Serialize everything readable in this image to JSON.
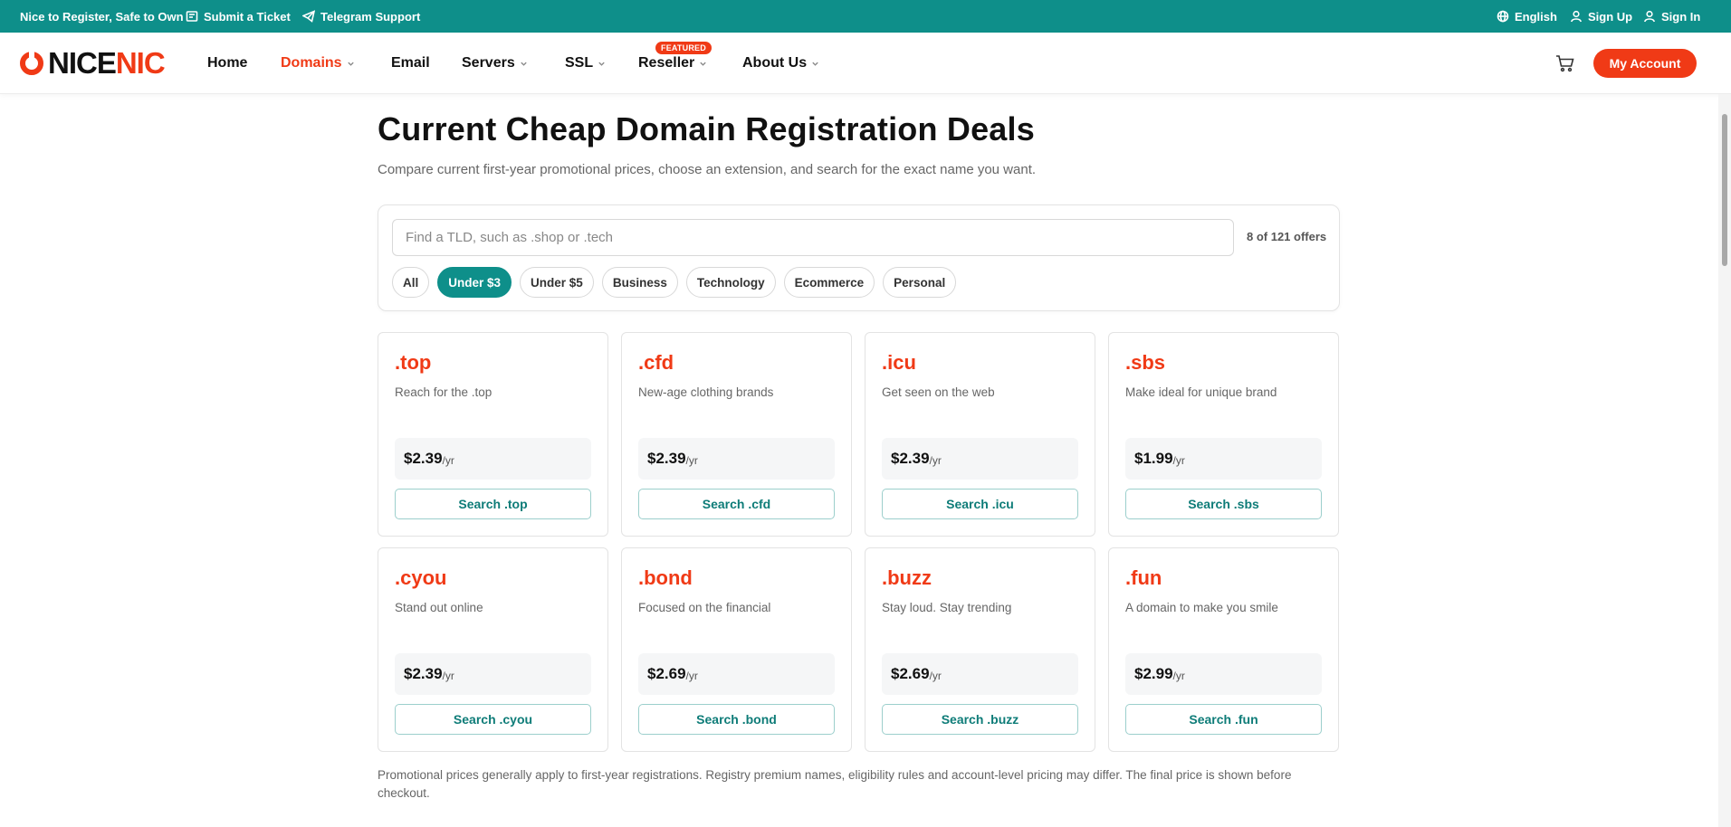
{
  "topbar": {
    "tagline": "Nice to Register, Safe to Own",
    "ticket": "Submit a Ticket",
    "telegram": "Telegram Support",
    "language": "English",
    "signup": "Sign Up",
    "signin": "Sign In",
    "color": "#0e8f8a"
  },
  "nav": {
    "logo_a": "NICE",
    "logo_b": "NIC",
    "home": "Home",
    "domains": "Domains",
    "email": "Email",
    "servers": "Servers",
    "ssl": "SSL",
    "reseller": "Reseller",
    "featured": "FEATURED",
    "about": "About Us",
    "account": "My Account",
    "accent": "#f03a16"
  },
  "main": {
    "title": "Current Cheap Domain Registration Deals",
    "subtitle": "Compare current first-year promotional prices, choose an extension, and search for the exact name you want.",
    "search_placeholder": "Find a TLD, such as .shop or .tech",
    "offer_count": "8 of 121 offers",
    "filters": [
      "All",
      "Under $3",
      "Under $5",
      "Business",
      "Technology",
      "Ecommerce",
      "Personal"
    ],
    "active_filter": "Under $3",
    "per_year": "/yr",
    "cards": [
      {
        "tld": ".top",
        "desc": "Reach for the .top",
        "price": "$2.39",
        "button": "Search .top"
      },
      {
        "tld": ".cfd",
        "desc": "New-age clothing brands",
        "price": "$2.39",
        "button": "Search .cfd"
      },
      {
        "tld": ".icu",
        "desc": "Get seen on the web",
        "price": "$2.39",
        "button": "Search .icu"
      },
      {
        "tld": ".sbs",
        "desc": "Make ideal for unique brand",
        "price": "$1.99",
        "button": "Search .sbs"
      },
      {
        "tld": ".cyou",
        "desc": "Stand out online",
        "price": "$2.39",
        "button": "Search .cyou"
      },
      {
        "tld": ".bond",
        "desc": "Focused on the financial",
        "price": "$2.69",
        "button": "Search .bond"
      },
      {
        "tld": ".buzz",
        "desc": "Stay loud. Stay trending",
        "price": "$2.69",
        "button": "Search .buzz"
      },
      {
        "tld": ".fun",
        "desc": "A domain to make you smile",
        "price": "$2.99",
        "button": "Search .fun"
      }
    ],
    "disclaimer": "Promotional prices generally apply to first-year registrations. Registry premium names, eligibility rules and account-level pricing may differ. The final price is shown before checkout."
  }
}
